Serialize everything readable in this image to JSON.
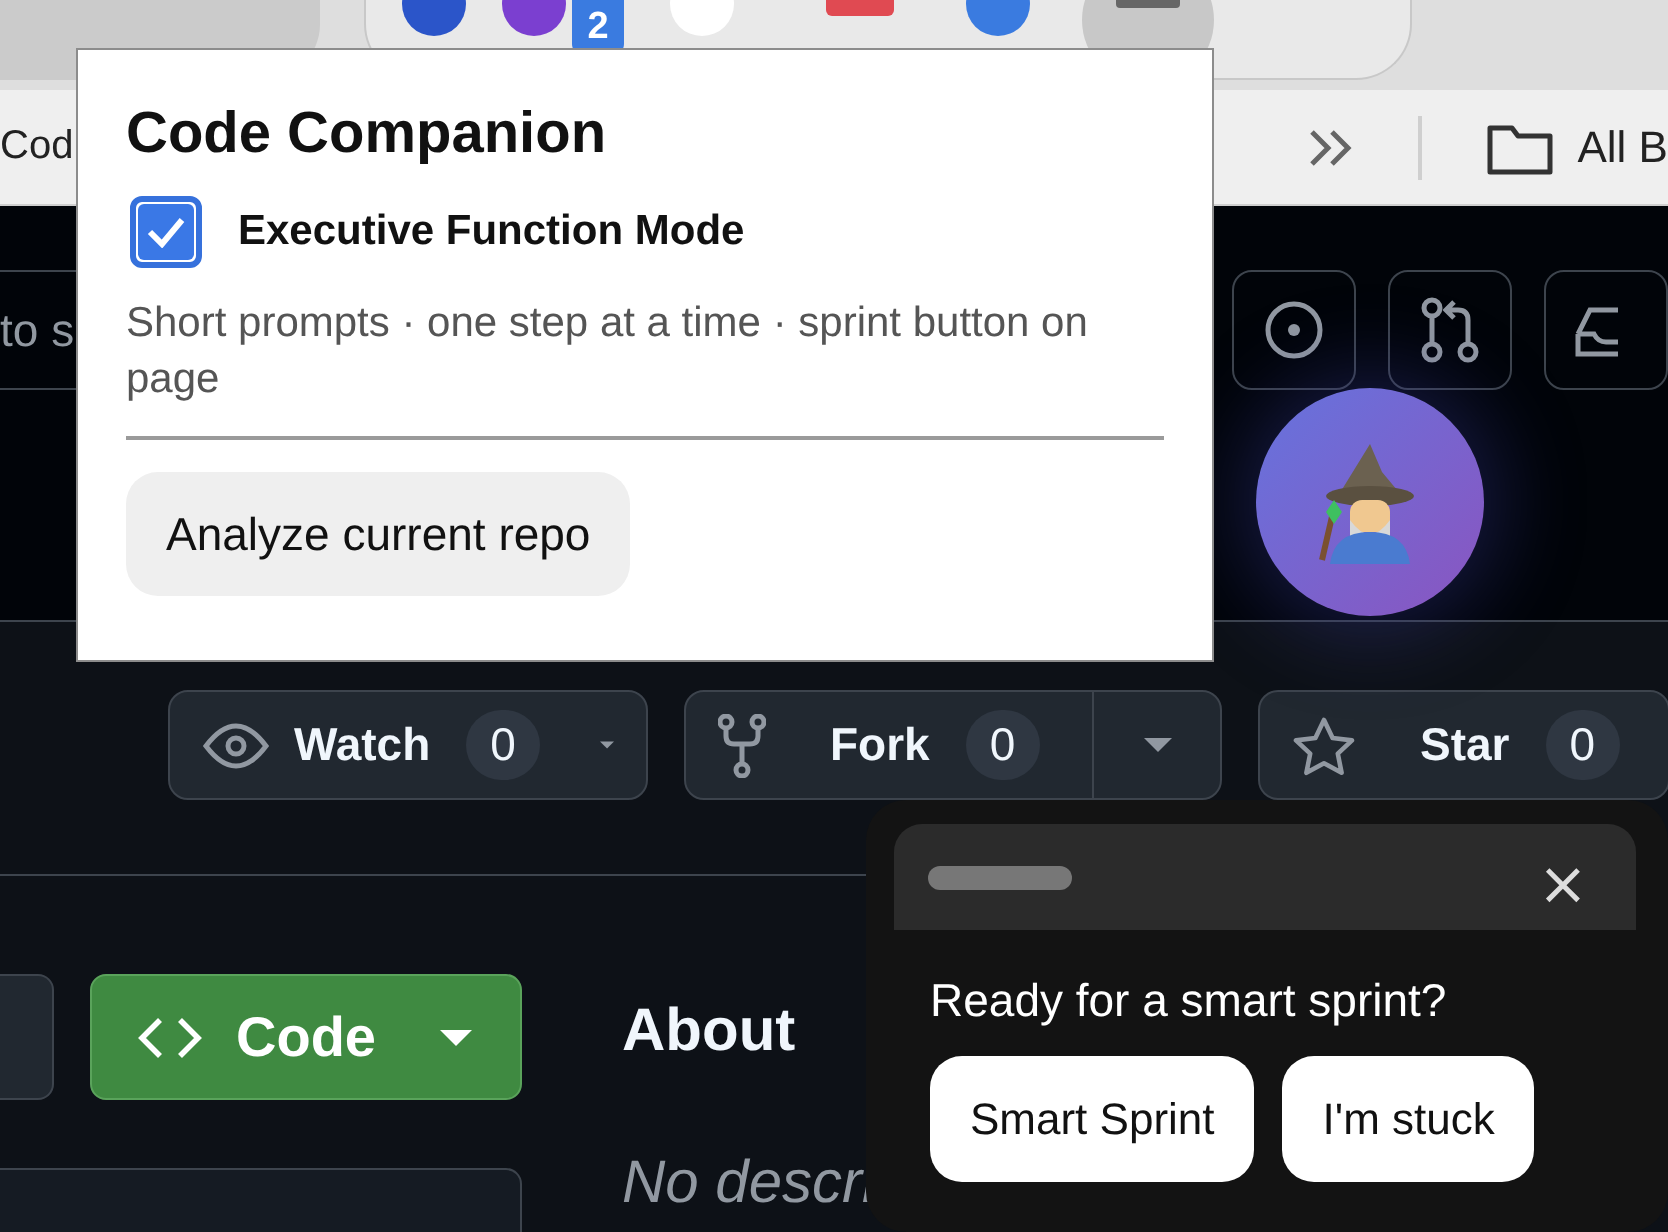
{
  "browser": {
    "tab_badge": "2",
    "bookmark": "Cod",
    "folder": "All B"
  },
  "header": {
    "search_text": "to s"
  },
  "repo_actions": [
    {
      "kind": "watch",
      "label": "Watch",
      "count": "0"
    },
    {
      "kind": "fork",
      "label": "Fork",
      "count": "0"
    },
    {
      "kind": "star",
      "label": "Star",
      "count": "0"
    }
  ],
  "code_button": {
    "label": "Code"
  },
  "about": {
    "title": "About",
    "description": "No descri"
  },
  "extension_popup": {
    "title": "Code Companion",
    "mode": {
      "label": "Executive Function Mode",
      "checked": true
    },
    "description": "Short prompts · one step at a time · sprint button on page",
    "action": "Analyze current repo"
  },
  "sprint_panel": {
    "close": "×",
    "prompt": "Ready for a smart sprint?",
    "buttons": [
      "Smart Sprint",
      "I'm stuck"
    ]
  }
}
